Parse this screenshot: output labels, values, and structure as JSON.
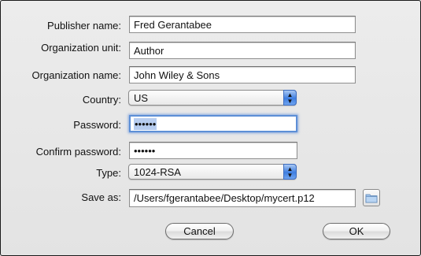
{
  "form": {
    "publisher_name": {
      "label": "Publisher name:",
      "value": "Fred Gerantabee"
    },
    "organization_unit": {
      "label": "Organization unit:",
      "value": "Author"
    },
    "organization_name": {
      "label": "Organization name:",
      "value": "John Wiley & Sons"
    },
    "country": {
      "label": "Country:",
      "value": "US"
    },
    "password": {
      "label": "Password:",
      "value": "••••••"
    },
    "confirm_password": {
      "label": "Confirm password:",
      "value": "••••••"
    },
    "type": {
      "label": "Type:",
      "value": "1024-RSA"
    },
    "save_as": {
      "label": "Save as:",
      "value": "/Users/fgerantabee/Desktop/mycert.p12"
    }
  },
  "buttons": {
    "cancel": "Cancel",
    "ok": "OK"
  },
  "colors": {
    "focus_ring": "#5d8fd6",
    "popup_arrow": "#3f7ee0"
  }
}
